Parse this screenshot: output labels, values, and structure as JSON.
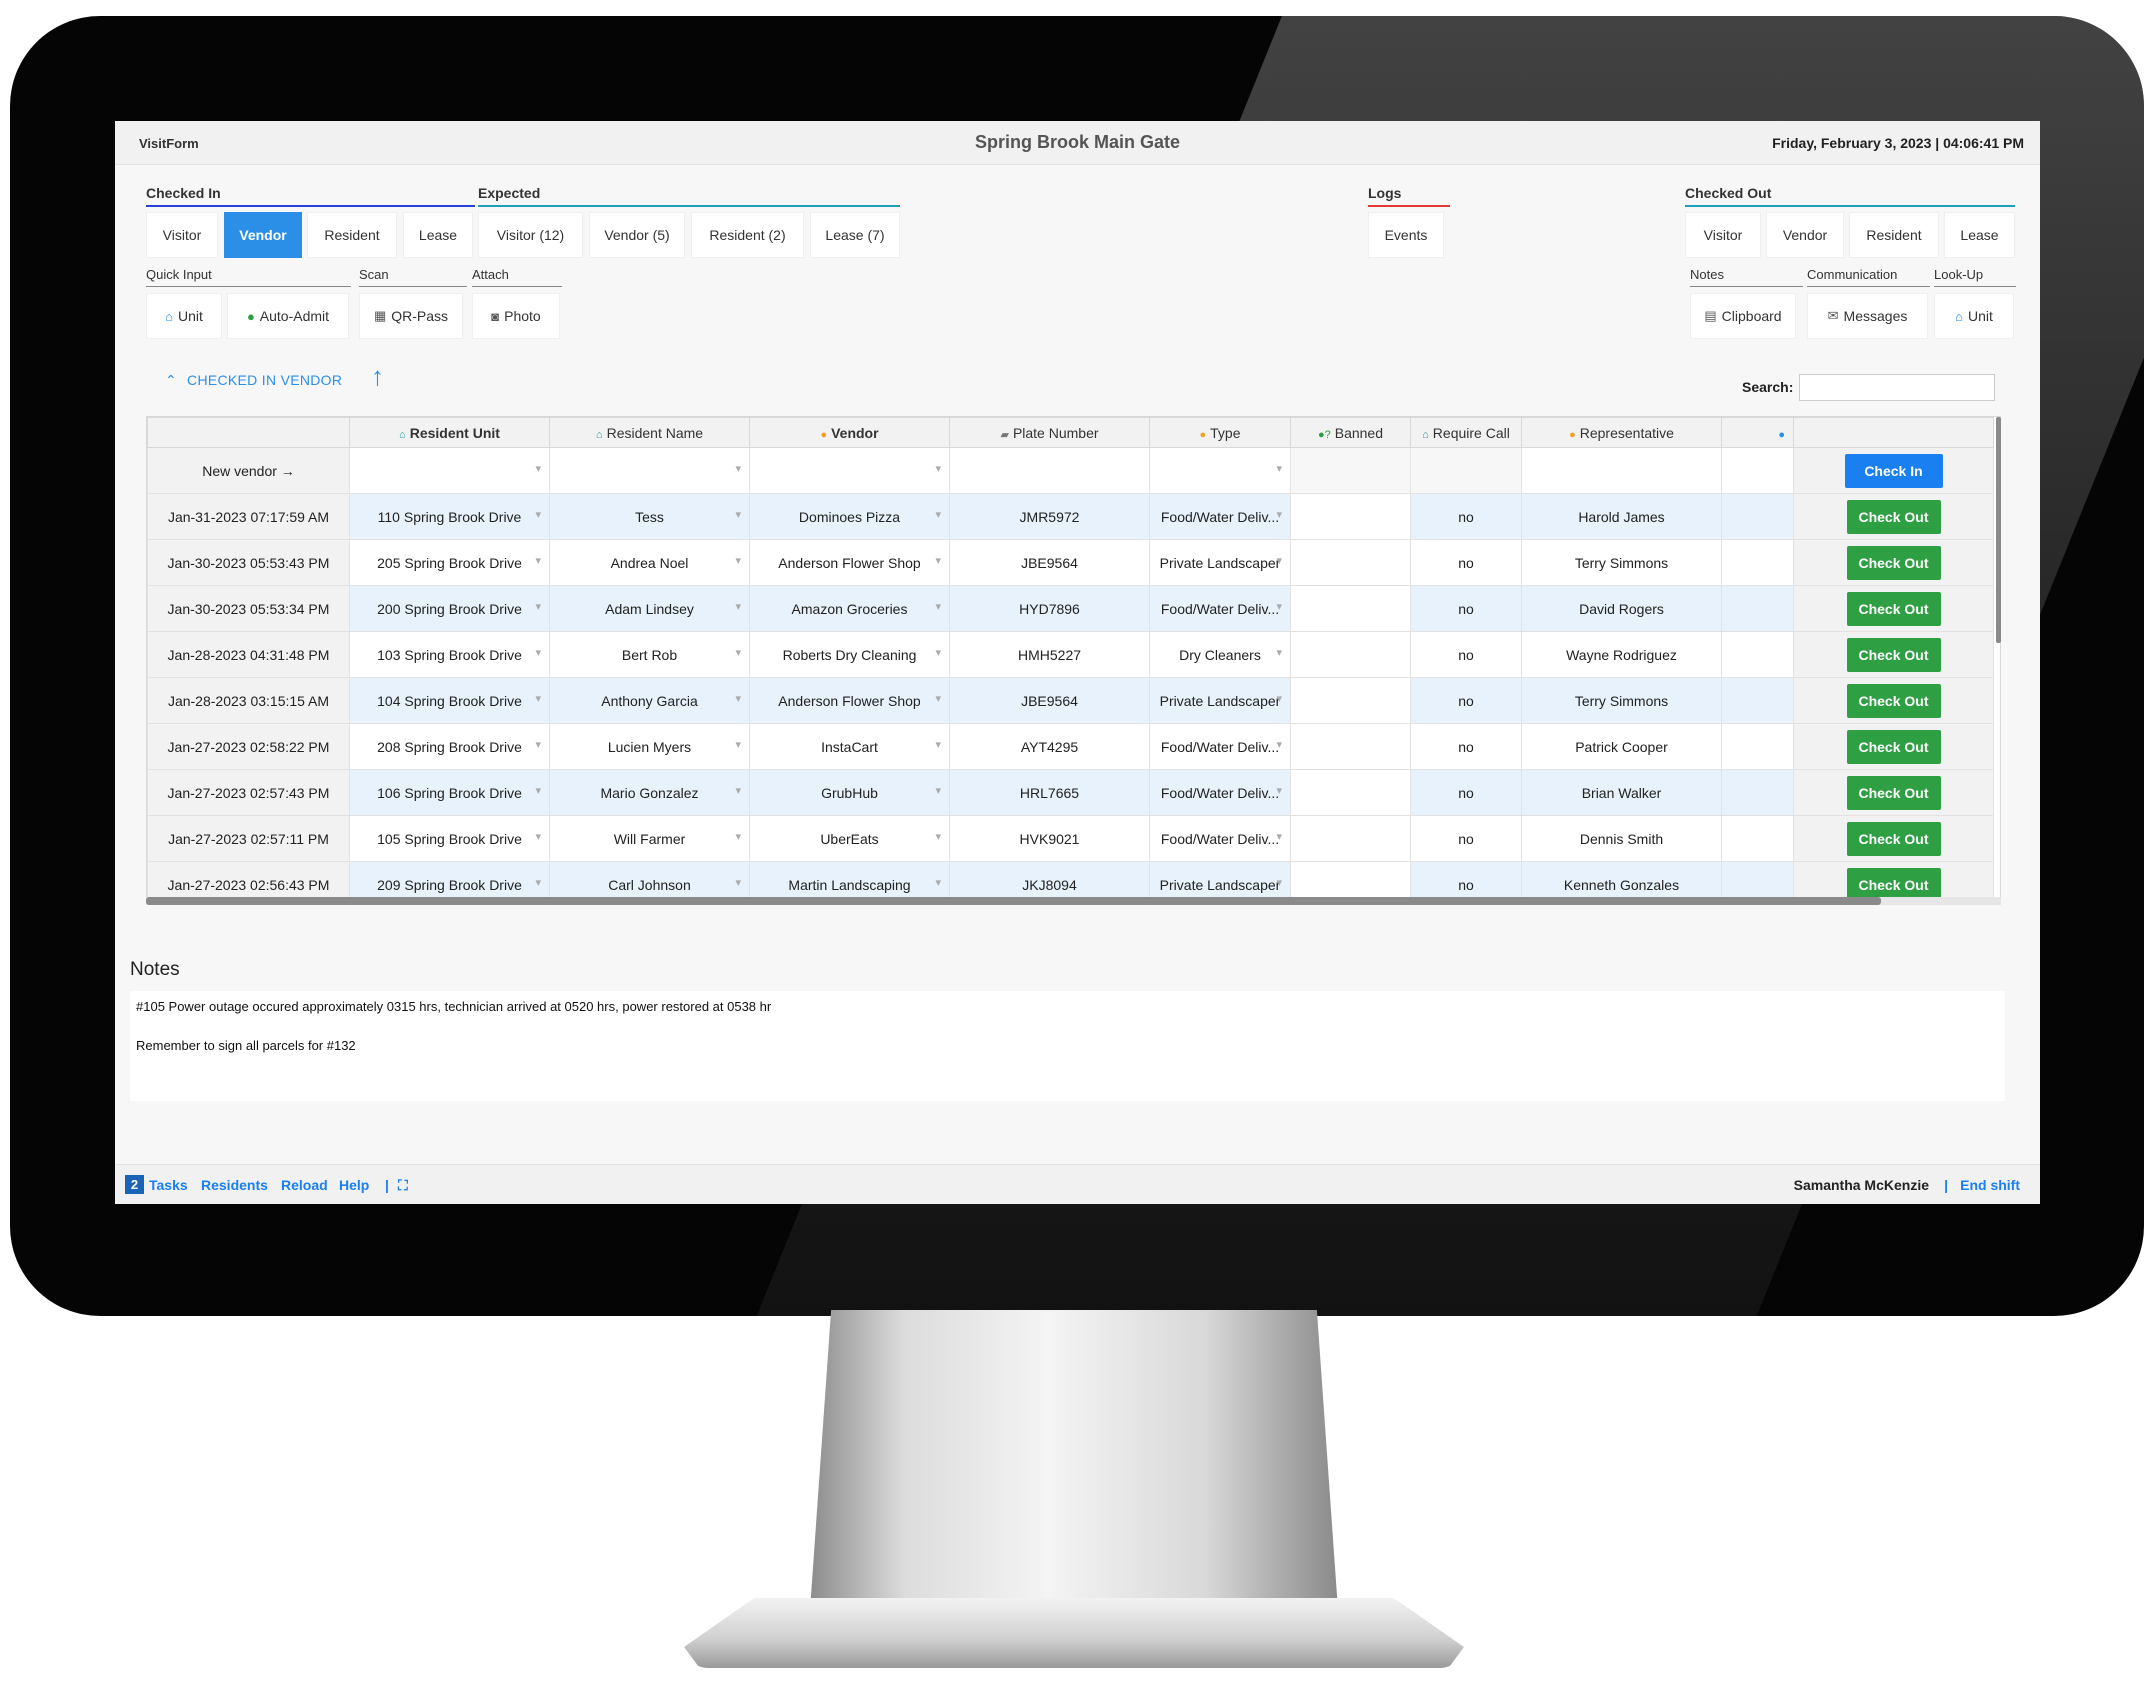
{
  "header": {
    "brand": "VisitForm",
    "title": "Spring Brook Main Gate",
    "datetime": "Friday, February 3, 2023 | 04:06:41 PM"
  },
  "groups": {
    "checked_in": {
      "label": "Checked In",
      "color": "#2b3fd8",
      "tabs": [
        "Visitor",
        "Vendor",
        "Resident",
        "Lease"
      ],
      "active_tab": "Vendor"
    },
    "expected": {
      "label": "Expected",
      "color": "#1fa0b8",
      "tabs": [
        "Visitor (12)",
        "Vendor (5)",
        "Resident (2)",
        "Lease (7)"
      ]
    },
    "logs": {
      "label": "Logs",
      "color": "#e53935",
      "tabs": [
        "Events"
      ]
    },
    "checked_out": {
      "label": "Checked Out",
      "color": "#1fa0b8",
      "tabs": [
        "Visitor",
        "Vendor",
        "Resident",
        "Lease"
      ]
    },
    "quick_input": {
      "label": "Quick Input",
      "buttons": [
        {
          "icon": "home-icon",
          "label": "Unit"
        },
        {
          "icon": "user-icon",
          "label": "Auto-Admit"
        }
      ]
    },
    "scan": {
      "label": "Scan",
      "buttons": [
        {
          "icon": "qr-icon",
          "label": "QR-Pass"
        }
      ]
    },
    "attach": {
      "label": "Attach",
      "buttons": [
        {
          "icon": "camera-icon",
          "label": "Photo"
        }
      ]
    },
    "notes": {
      "label": "Notes",
      "buttons": [
        {
          "icon": "clipboard-icon",
          "label": "Clipboard"
        }
      ]
    },
    "communication": {
      "label": "Communication",
      "buttons": [
        {
          "icon": "chat-icon",
          "label": "Messages"
        }
      ]
    },
    "lookup": {
      "label": "Look-Up",
      "buttons": [
        {
          "icon": "home-icon",
          "label": "Unit"
        }
      ]
    }
  },
  "section": {
    "toggle_label": "CHECKED IN VENDOR",
    "search_label": "Search:",
    "search_value": ""
  },
  "grid": {
    "columns": [
      "Resident Unit",
      "Resident Name",
      "Vendor",
      "Plate Number",
      "Type",
      "Banned",
      "Require Call",
      "Representative",
      ""
    ],
    "new_vendor_label": "New vendor",
    "check_in_label": "Check In",
    "check_out_label": "Check Out",
    "rows": [
      {
        "date": "Jan-31-2023 07:17:59 AM",
        "unit": "110 Spring Brook Drive",
        "name": "Tess",
        "vendor": "Dominoes Pizza",
        "plate": "JMR5972",
        "type": "Food/Water Deliv...",
        "banned": "",
        "call": "no",
        "rep": "Harold James"
      },
      {
        "date": "Jan-30-2023 05:53:43 PM",
        "unit": "205 Spring Brook Drive",
        "name": "Andrea Noel",
        "vendor": "Anderson Flower Shop",
        "plate": "JBE9564",
        "type": "Private Landscaper",
        "banned": "",
        "call": "no",
        "rep": "Terry Simmons"
      },
      {
        "date": "Jan-30-2023 05:53:34 PM",
        "unit": "200 Spring Brook Drive",
        "name": "Adam Lindsey",
        "vendor": "Amazon Groceries",
        "plate": "HYD7896",
        "type": "Food/Water Deliv...",
        "banned": "",
        "call": "no",
        "rep": "David Rogers"
      },
      {
        "date": "Jan-28-2023 04:31:48 PM",
        "unit": "103 Spring Brook Drive",
        "name": "Bert Rob",
        "vendor": "Roberts Dry Cleaning",
        "plate": "HMH5227",
        "type": "Dry Cleaners",
        "banned": "",
        "call": "no",
        "rep": "Wayne Rodriguez"
      },
      {
        "date": "Jan-28-2023 03:15:15 AM",
        "unit": "104 Spring Brook Drive",
        "name": "Anthony Garcia",
        "vendor": "Anderson Flower Shop",
        "plate": "JBE9564",
        "type": "Private Landscaper",
        "banned": "",
        "call": "no",
        "rep": "Terry Simmons"
      },
      {
        "date": "Jan-27-2023 02:58:22 PM",
        "unit": "208 Spring Brook Drive",
        "name": "Lucien Myers",
        "vendor": "InstaCart",
        "plate": "AYT4295",
        "type": "Food/Water Deliv...",
        "banned": "",
        "call": "no",
        "rep": "Patrick Cooper"
      },
      {
        "date": "Jan-27-2023 02:57:43 PM",
        "unit": "106 Spring Brook Drive",
        "name": "Mario Gonzalez",
        "vendor": "GrubHub",
        "plate": "HRL7665",
        "type": "Food/Water Deliv...",
        "banned": "",
        "call": "no",
        "rep": "Brian Walker"
      },
      {
        "date": "Jan-27-2023 02:57:11 PM",
        "unit": "105 Spring Brook Drive",
        "name": "Will Farmer",
        "vendor": "UberEats",
        "plate": "HVK9021",
        "type": "Food/Water Deliv...",
        "banned": "",
        "call": "no",
        "rep": "Dennis Smith"
      },
      {
        "date": "Jan-27-2023 02:56:43 PM",
        "unit": "209 Spring Brook Drive",
        "name": "Carl Johnson",
        "vendor": "Martin Landscaping",
        "plate": "JKJ8094",
        "type": "Private Landscaper",
        "banned": "",
        "call": "no",
        "rep": "Kenneth Gonzales"
      }
    ]
  },
  "notes": {
    "title": "Notes",
    "lines": [
      "#105 Power outage occured approximately 0315 hrs, technician arrived at 0520 hrs, power restored at 0538 hr",
      "Remember to sign all parcels for #132"
    ]
  },
  "footer": {
    "tasks_count": "2",
    "tasks_label": "Tasks",
    "residents_label": "Residents",
    "reload_label": "Reload",
    "help_label": "Help",
    "separator": "|",
    "user_name": "Samantha McKenzie",
    "end_shift_label": "End shift"
  }
}
